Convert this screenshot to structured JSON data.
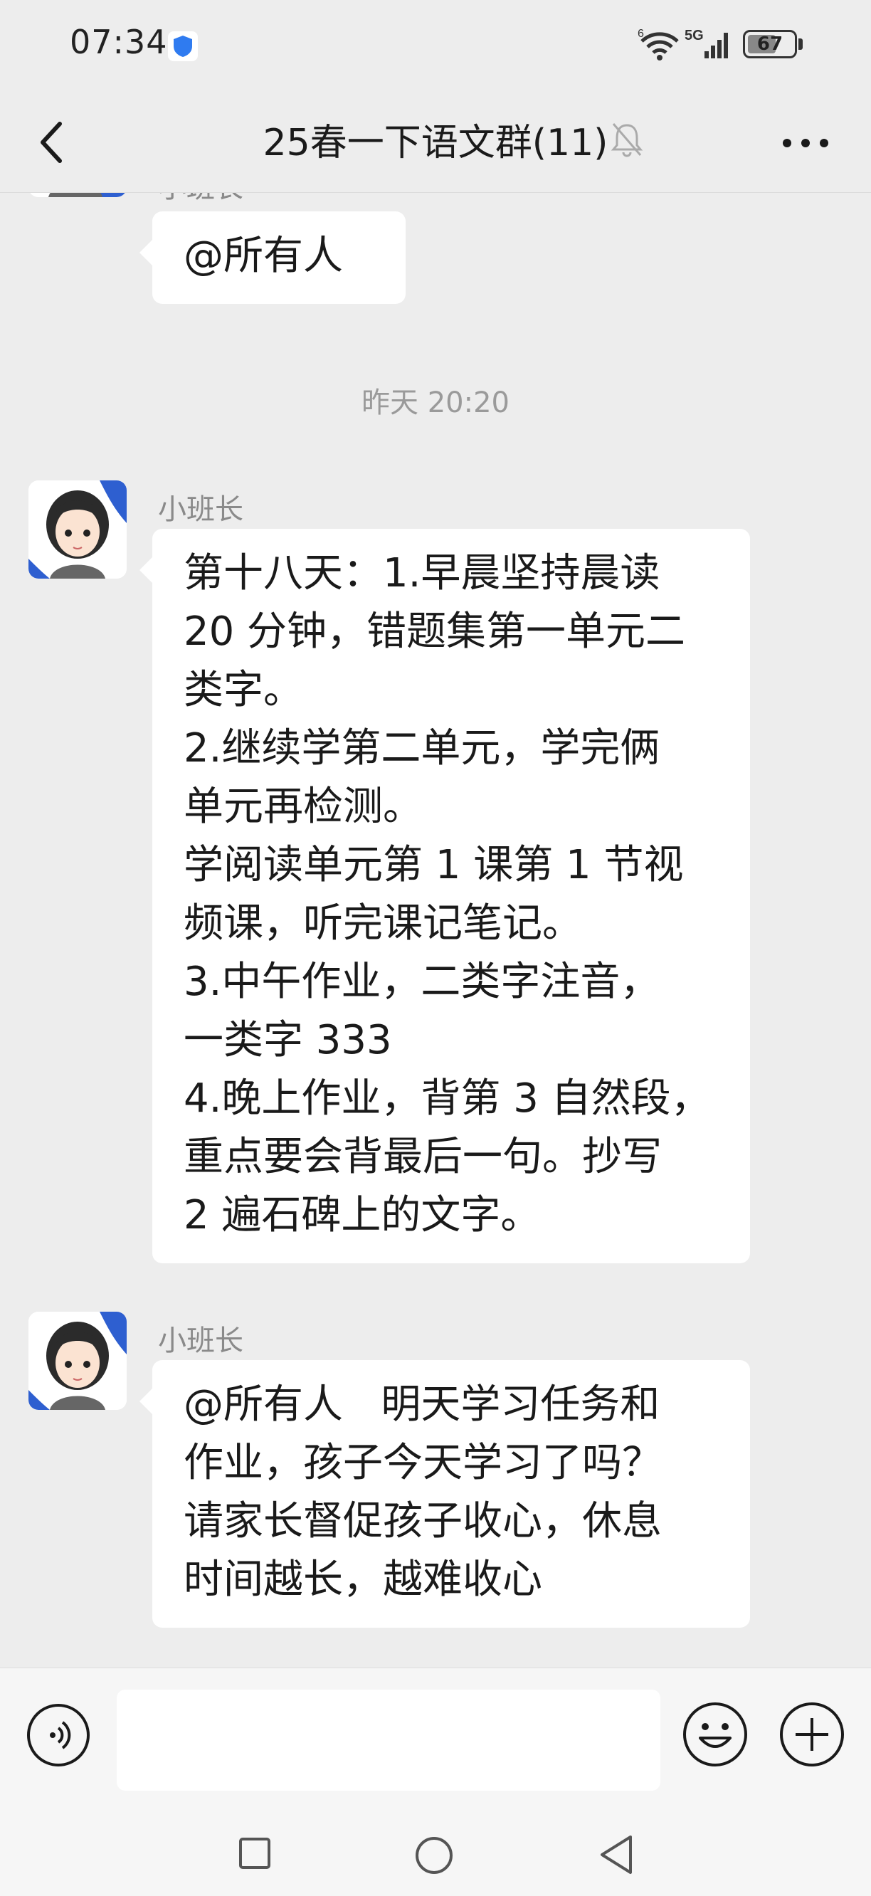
{
  "status_bar": {
    "time": "07:34",
    "battery": "67",
    "battery_level": 0.67,
    "network": "5G",
    "wifi_badge": "6",
    "icons": [
      "shield-icon",
      "wifi-icon",
      "signal-icon",
      "battery-icon"
    ]
  },
  "header": {
    "title": "25春一下语文群(11)",
    "icons": [
      "back-icon",
      "mute-bell-icon",
      "more-icon"
    ]
  },
  "messages": [
    {
      "sender": "小班长",
      "lines": [
        "@所有人"
      ]
    },
    {
      "timestamp": "昨天 20:20"
    },
    {
      "sender": "小班长",
      "lines": [
        "第十八天：1.早晨坚持晨读",
        "20 分钟，错题集第一单元二",
        "类字。",
        "2.继续学第二单元，学完俩",
        "单元再检测。",
        "学阅读单元第 1 课第 1 节视",
        "频课，听完课记笔记。",
        "3.中午作业，二类字注音，",
        "一类字 333",
        "4.晚上作业，背第 3 自然段，",
        "重点要会背最后一句。抄写",
        "2 遍石碑上的文字。"
      ]
    },
    {
      "sender": "小班长",
      "lines": [
        "@所有人   明天学习任务和",
        "作业，孩子今天学习了吗？",
        "请家长督促孩子收心，休息",
        "时间越长，越难收心"
      ]
    }
  ],
  "input_bar": {
    "placeholder": "",
    "icons": [
      "voice-icon",
      "emoji-icon",
      "plus-icon"
    ]
  },
  "nav_bar": {
    "icons": [
      "recent-apps-icon",
      "home-icon",
      "back-triangle-icon"
    ]
  },
  "colors": {
    "background": "#ededed",
    "bubble": "#ffffff",
    "muted_text": "#8a8a8a",
    "avatar_accent": "#2e5fd0"
  }
}
